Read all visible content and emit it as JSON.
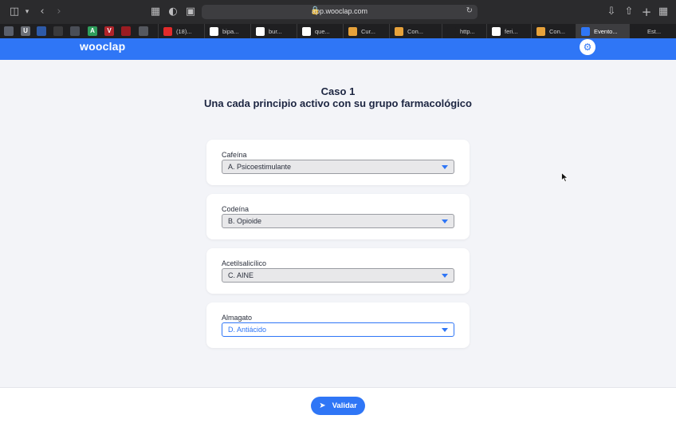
{
  "browser": {
    "url": "app.wooclap.com",
    "icons": {
      "sidebar": "sidebar-icon",
      "back": "chevron-left-icon",
      "forward": "chevron-right-icon",
      "download": "download-icon",
      "share": "share-icon",
      "new_tab": "plus-icon",
      "tab_overview": "grid-icon"
    },
    "pinned": [
      {
        "name": "pinned-tab-1",
        "text": "",
        "color": "#5a5f6b"
      },
      {
        "name": "pinned-tab-2",
        "text": "U",
        "color": "#6b6f77"
      },
      {
        "name": "pinned-tab-3",
        "text": "",
        "color": "#2e5aa8"
      },
      {
        "name": "pinned-tab-4",
        "text": "",
        "color": "#3a3a3c"
      },
      {
        "name": "pinned-tab-5",
        "text": "",
        "color": "#4a4e57"
      },
      {
        "name": "pinned-tab-6",
        "text": "A",
        "color": "#2f9e5c"
      },
      {
        "name": "pinned-tab-7",
        "text": "V",
        "color": "#b0242b"
      },
      {
        "name": "pinned-tab-8",
        "text": "",
        "color": "#9b1c22"
      },
      {
        "name": "pinned-tab-9",
        "text": "",
        "color": "#55585f"
      }
    ],
    "tabs": [
      {
        "label": "(18)...",
        "icon": "youtube-icon",
        "fav_color": "#e22b2b",
        "active": false
      },
      {
        "label": "bipa...",
        "icon": "google-icon",
        "fav_color": "#ffffff",
        "active": false
      },
      {
        "label": "bur...",
        "icon": "google-icon",
        "fav_color": "#ffffff",
        "active": false
      },
      {
        "label": "que...",
        "icon": "google-icon",
        "fav_color": "#ffffff",
        "active": false
      },
      {
        "label": "Cur...",
        "icon": "chart-icon",
        "fav_color": "#e7a23b",
        "active": false
      },
      {
        "label": "Con...",
        "icon": "chart-icon",
        "fav_color": "#e7a23b",
        "active": false
      },
      {
        "label": "http...",
        "icon": "bb-icon",
        "fav_color": "#1f1f21",
        "active": false
      },
      {
        "label": "feri...",
        "icon": "google-icon",
        "fav_color": "#ffffff",
        "active": false
      },
      {
        "label": "Con...",
        "icon": "chart-icon",
        "fav_color": "#e7a23b",
        "active": false
      },
      {
        "label": "Evento...",
        "icon": "wooclap-icon",
        "fav_color": "#2f76f6",
        "active": true
      },
      {
        "label": "Est...",
        "icon": "blank-page-icon",
        "fav_color": "#1f1f21",
        "active": false
      }
    ]
  },
  "app": {
    "logo": "wooclap",
    "settings_icon": "gear-icon",
    "title": "Caso 1",
    "subtitle": "Una cada principio activo con su grupo farmacológico",
    "items": [
      {
        "label": "Cafeína",
        "selected": "A. Psicoestimulante",
        "focused": false
      },
      {
        "label": "Codeína",
        "selected": "B. Opioide",
        "focused": false
      },
      {
        "label": "Acetilsalicílico",
        "selected": "C. AINE",
        "focused": false
      },
      {
        "label": "Almagato",
        "selected": "D. Antiácido",
        "focused": true
      }
    ],
    "submit_label": "Validar",
    "submit_icon": "paper-plane-icon",
    "accent": "#2f76f6"
  }
}
